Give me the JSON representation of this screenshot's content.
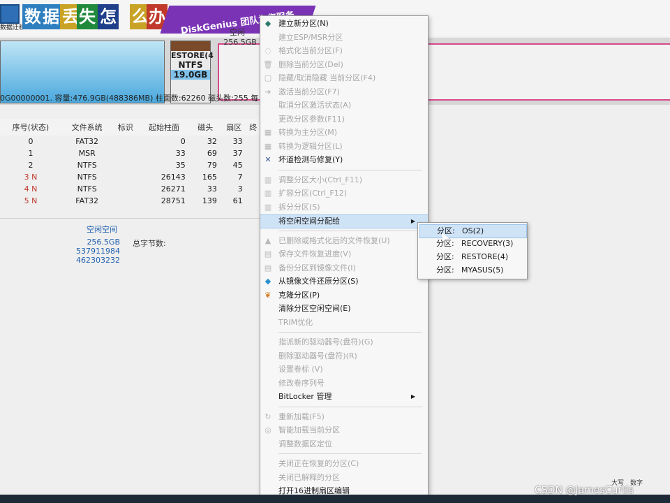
{
  "banner": {
    "tool_label": "数据迁移",
    "tiles": [
      {
        "char": "数",
        "color": "#2e7fbf"
      },
      {
        "char": "据",
        "color": "#2e7fbf"
      },
      {
        "char": "丢",
        "color": "#c9a326"
      },
      {
        "char": "失",
        "color": "#1f8a3c"
      },
      {
        "char": "怎",
        "color": "#1f3f8a"
      },
      {
        "char": "么",
        "color": "#c9a326"
      },
      {
        "char": "办",
        "color": "#c0392b"
      }
    ],
    "ad_text": "DiskGenius 团队为您服务"
  },
  "disk_map": {
    "restore_name": "ESTORE(4",
    "restore_fs": "NTFS",
    "restore_size": "19.0GB",
    "free_label": "空闲",
    "free_size": "256.5GB"
  },
  "disk_info": "0G00000001. 容量:476.9GB(488386MB) 柱面数:62260 磁头数:255 每",
  "table": {
    "headers": [
      "序号(状态)",
      "文件系统",
      "标识",
      "起始柱面",
      "磁头",
      "扇区",
      "终"
    ],
    "rows": [
      {
        "idx": "0",
        "fs": "FAT32",
        "id": "",
        "cyl": "0",
        "head": "32",
        "sec": "33"
      },
      {
        "idx": "1",
        "fs": "MSR",
        "id": "",
        "cyl": "33",
        "head": "69",
        "sec": "37"
      },
      {
        "idx": "2",
        "fs": "NTFS",
        "id": "",
        "cyl": "35",
        "head": "79",
        "sec": "45"
      },
      {
        "idx": "3 N",
        "fs": "NTFS",
        "id": "",
        "cyl": "26143",
        "head": "165",
        "sec": "7"
      },
      {
        "idx": "4 N",
        "fs": "NTFS",
        "id": "",
        "cyl": "26271",
        "head": "33",
        "sec": "3"
      },
      {
        "idx": "5 N",
        "fs": "FAT32",
        "id": "",
        "cyl": "28751",
        "head": "139",
        "sec": "61"
      }
    ]
  },
  "free_space": {
    "title": "空闲空间",
    "size": "256.5GB",
    "value2": "537911984",
    "value3": "462303232",
    "total_bytes_label": "总字节数:"
  },
  "context_menu": [
    {
      "label": "建立新分区(N)",
      "enabled": true,
      "icon": "new-partition-icon",
      "glyph": "◆"
    },
    {
      "label": "建立ESP/MSR分区",
      "enabled": false,
      "icon": "esp-icon",
      "glyph": ""
    },
    {
      "label": "格式化当前分区(F)",
      "enabled": false,
      "icon": "format-icon",
      "glyph": "◌"
    },
    {
      "label": "删除当前分区(Del)",
      "enabled": false,
      "icon": "delete-icon",
      "glyph": "🗑"
    },
    {
      "label": "隐藏/取消隐藏 当前分区(F4)",
      "enabled": false,
      "icon": "hide-icon",
      "glyph": "▢"
    },
    {
      "label": "激活当前分区(F7)",
      "enabled": false,
      "icon": "activate-icon",
      "glyph": "➜"
    },
    {
      "label": "取消分区激活状态(A)",
      "enabled": false,
      "icon": "",
      "glyph": ""
    },
    {
      "label": "更改分区参数(F11)",
      "enabled": false,
      "icon": "",
      "glyph": ""
    },
    {
      "label": "转换为主分区(M)",
      "enabled": false,
      "icon": "convert-primary-icon",
      "glyph": "▦"
    },
    {
      "label": "转换为逻辑分区(L)",
      "enabled": false,
      "icon": "convert-logical-icon",
      "glyph": "▦"
    },
    {
      "label": "坏道检测与修复(Y)",
      "enabled": true,
      "icon": "tools-icon",
      "glyph": "✕"
    },
    {
      "label": "调整分区大小(Ctrl_F11)",
      "enabled": false,
      "icon": "resize-icon",
      "glyph": "▥"
    },
    {
      "label": "扩容分区(Ctrl_F12)",
      "enabled": false,
      "icon": "extend-icon",
      "glyph": "▥"
    },
    {
      "label": "拆分分区(S)",
      "enabled": false,
      "icon": "split-icon",
      "glyph": "▥"
    },
    {
      "label": "将空闲空间分配给",
      "enabled": true,
      "icon": "",
      "glyph": "",
      "submenu": true,
      "highlight": true
    },
    {
      "label": "已删除或格式化后的文件恢复(U)",
      "enabled": false,
      "icon": "recover-icon",
      "glyph": "▲"
    },
    {
      "label": "保存文件恢复进度(V)",
      "enabled": false,
      "icon": "save-progress-icon",
      "glyph": "▤"
    },
    {
      "label": "备份分区到镜像文件(I)",
      "enabled": false,
      "icon": "backup-icon",
      "glyph": "▤"
    },
    {
      "label": "从镜像文件还原分区(S)",
      "enabled": true,
      "icon": "restore-image-icon",
      "glyph": "◆"
    },
    {
      "label": "克隆分区(P)",
      "enabled": true,
      "icon": "clone-icon",
      "glyph": "❦"
    },
    {
      "label": "清除分区空闲空间(E)",
      "enabled": true,
      "icon": "",
      "glyph": ""
    },
    {
      "label": "TRIM优化",
      "enabled": false,
      "icon": "",
      "glyph": ""
    },
    {
      "label": "指派新的驱动器号(盘符)(G)",
      "enabled": false,
      "icon": "",
      "glyph": ""
    },
    {
      "label": "删除驱动器号(盘符)(R)",
      "enabled": false,
      "icon": "",
      "glyph": ""
    },
    {
      "label": "设置卷标 (V)",
      "enabled": false,
      "icon": "",
      "glyph": ""
    },
    {
      "label": "修改卷序列号",
      "enabled": false,
      "icon": "",
      "glyph": ""
    },
    {
      "label": "BitLocker 管理",
      "enabled": true,
      "icon": "",
      "glyph": "",
      "submenu": true
    },
    {
      "label": "重新加载(F5)",
      "enabled": false,
      "icon": "reload-icon",
      "glyph": "↻"
    },
    {
      "label": "智能加载当前分区",
      "enabled": false,
      "icon": "smart-load-icon",
      "glyph": "◎"
    },
    {
      "label": "调整数据区定位",
      "enabled": false,
      "icon": "",
      "glyph": ""
    },
    {
      "label": "关闭正在恢复的分区(C)",
      "enabled": false,
      "icon": "",
      "glyph": ""
    },
    {
      "label": "关闭已解释的分区",
      "enabled": false,
      "icon": "",
      "glyph": ""
    },
    {
      "label": "打开16进制扇区编辑",
      "enabled": true,
      "icon": "",
      "glyph": ""
    }
  ],
  "submenu": [
    {
      "prefix": "分区:",
      "name": "OS(2)"
    },
    {
      "prefix": "分区:",
      "name": "RECOVERY(3)"
    },
    {
      "prefix": "分区:",
      "name": "RESTORE(4)"
    },
    {
      "prefix": "分区:",
      "name": "MYASUS(5)"
    }
  ],
  "status": {
    "right_text": "大写　数字"
  },
  "watermark": "CSDN @JamesCurtis"
}
